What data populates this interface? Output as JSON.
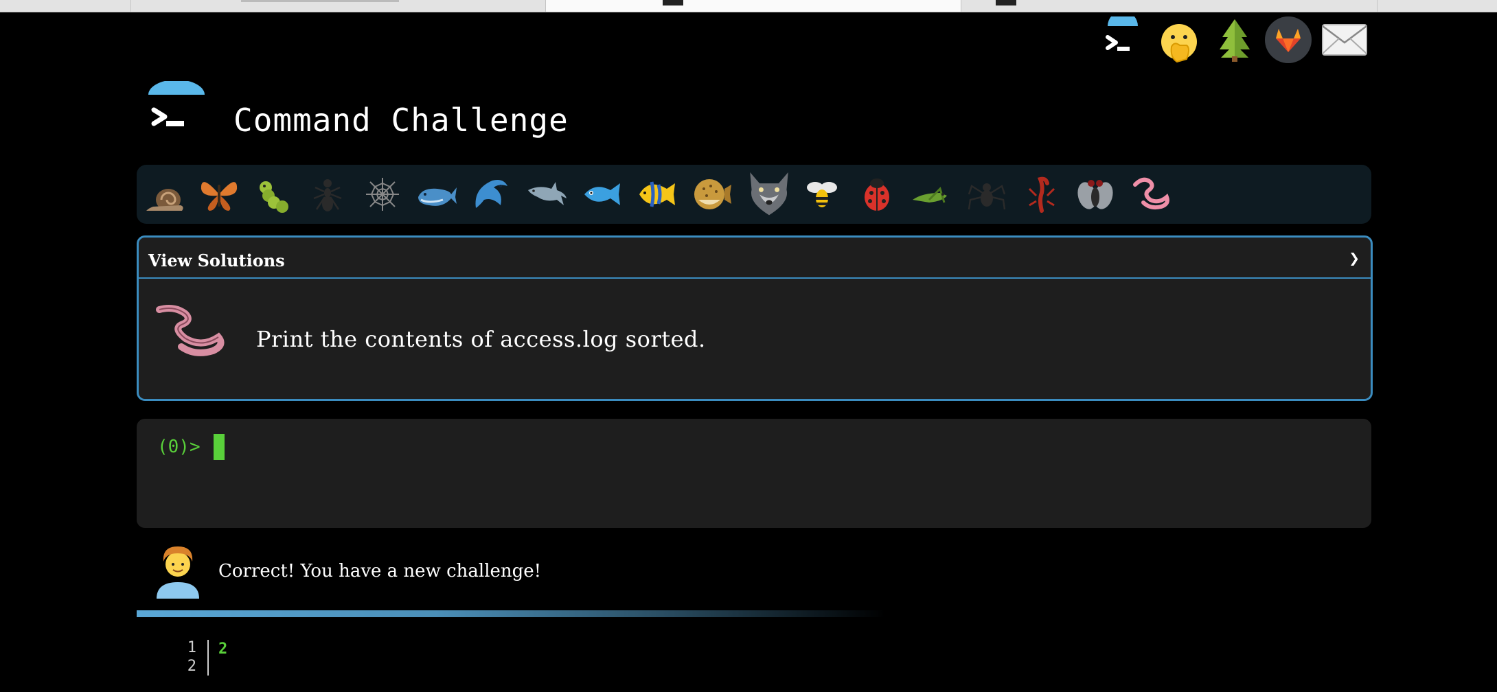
{
  "browser": {
    "tabs": [
      {
        "name": "tab-1"
      },
      {
        "name": "tab-2"
      },
      {
        "name": "tab-3-active"
      },
      {
        "name": "tab-4"
      }
    ]
  },
  "header": {
    "title": "Command Challenge",
    "logo_icon": "terminal-logo-icon",
    "top_icons": [
      "terminal-icon",
      "face-with-hand-over-mouth-icon",
      "evergreen-tree-icon",
      "gitlab-icon",
      "envelope-icon"
    ]
  },
  "levels": {
    "icons": [
      "snail-icon",
      "butterfly-icon",
      "caterpillar-icon",
      "ant-icon",
      "spider-web-icon",
      "whale-icon",
      "dolphin-jump-icon",
      "dolphin-icon",
      "fish-icon",
      "tropical-fish-icon",
      "blowfish-icon",
      "wolf-icon",
      "bee-icon",
      "ladybug-icon",
      "cricket-icon",
      "spider-icon",
      "scorpion-icon",
      "fly-icon",
      "worm-icon"
    ]
  },
  "challenge": {
    "view_solutions_label": "View Solutions",
    "chevron": "❯",
    "prompt": "Print the contents of access.log sorted.",
    "icon": "worm-icon"
  },
  "terminal": {
    "prompt": "(0)>"
  },
  "feedback": {
    "message": "Correct! You have a new challenge!",
    "avatar_icon": "person-curly-hair-icon"
  },
  "output": {
    "line_numbers": [
      "1",
      "2"
    ],
    "text": "2"
  },
  "colors": {
    "accent": "#3b8cbf",
    "terminal_green": "#59d03a",
    "panel_bg": "#1e1e1e",
    "bugbar_bg": "#0e1b22"
  }
}
